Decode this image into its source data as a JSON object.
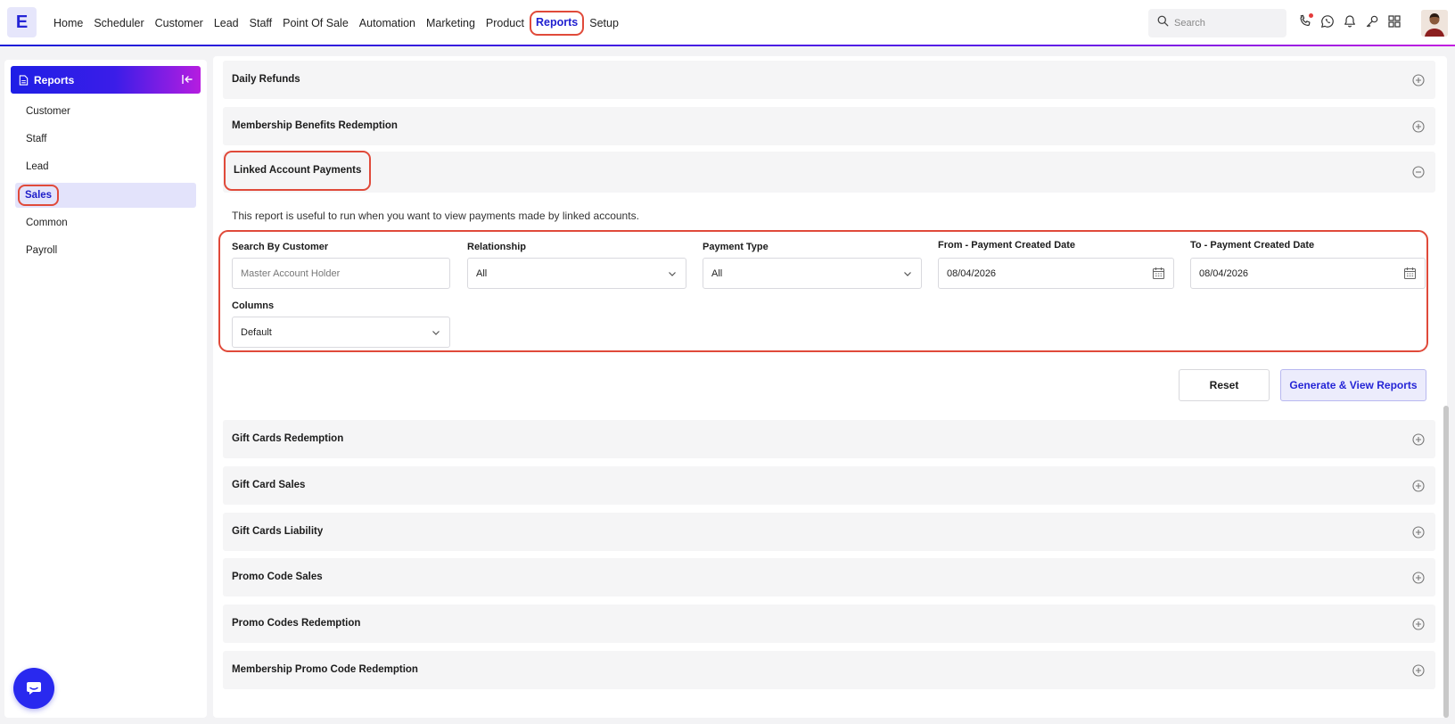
{
  "app": {
    "logo_letter": "E"
  },
  "nav": {
    "items": [
      "Home",
      "Scheduler",
      "Customer",
      "Lead",
      "Staff",
      "Point Of Sale",
      "Automation",
      "Marketing",
      "Product",
      "Reports",
      "Setup"
    ],
    "active": "Reports"
  },
  "search": {
    "placeholder": "Search"
  },
  "header_icons": [
    "phone-icon",
    "whatsapp-icon",
    "bell-icon",
    "key-icon",
    "apps-grid-icon"
  ],
  "sidebar": {
    "title": "Reports",
    "items": [
      {
        "label": "Customer"
      },
      {
        "label": "Staff"
      },
      {
        "label": "Lead"
      },
      {
        "label": "Sales"
      },
      {
        "label": "Common"
      },
      {
        "label": "Payroll"
      }
    ],
    "active": "Sales"
  },
  "reports": {
    "above": [
      {
        "title": "Daily Refunds"
      },
      {
        "title": "Membership Benefits Redemption"
      }
    ],
    "expanded": {
      "title": "Linked Account Payments",
      "description": "This report is useful to run when you want to view payments made by linked accounts.",
      "filters": {
        "search_customer": {
          "label": "Search By Customer",
          "placeholder": "Master Account Holder"
        },
        "relationship": {
          "label": "Relationship",
          "value": "All"
        },
        "payment_type": {
          "label": "Payment Type",
          "value": "All"
        },
        "from_date": {
          "label": "From - Payment Created Date",
          "value": "08/04/2026"
        },
        "to_date": {
          "label": "To - Payment Created Date",
          "value": "08/04/2026"
        },
        "columns": {
          "label": "Columns",
          "value": "Default"
        }
      },
      "buttons": {
        "reset": "Reset",
        "generate": "Generate & View Reports"
      }
    },
    "below": [
      {
        "title": "Gift Cards Redemption"
      },
      {
        "title": "Gift Card Sales"
      },
      {
        "title": "Gift Cards Liability"
      },
      {
        "title": "Promo Code Sales"
      },
      {
        "title": "Promo Codes Redemption"
      },
      {
        "title": "Membership Promo Code Redemption"
      }
    ]
  },
  "colors": {
    "brand": "#2020d0",
    "highlight": "#e04a3a",
    "panel_bg": "#f5f5f6"
  }
}
